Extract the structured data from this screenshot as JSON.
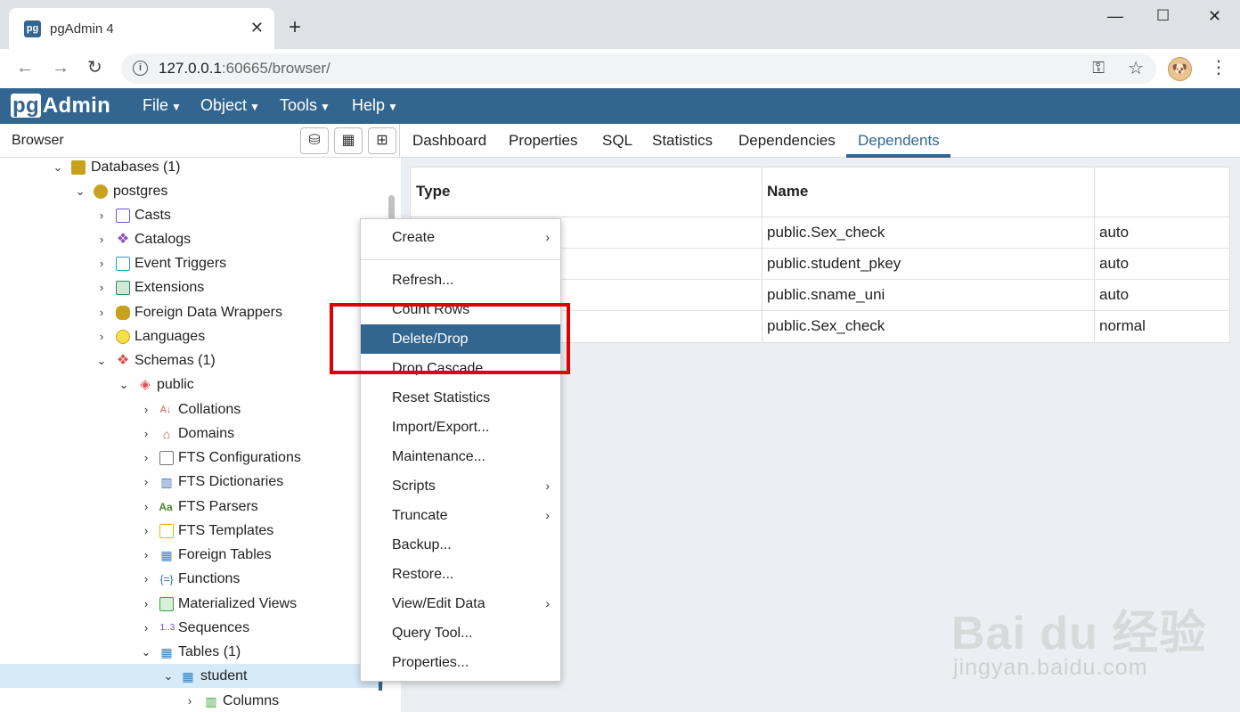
{
  "browser": {
    "tab_title": "pgAdmin 4",
    "tab_favicon": "pg",
    "url_host": "127.0.0.1",
    "url_path": ":60665/browser/"
  },
  "app": {
    "logo_pg": "pg",
    "logo_rest": "Admin",
    "menus": [
      "File",
      "Object",
      "Tools",
      "Help"
    ]
  },
  "left_panel": {
    "title": "Browser",
    "tree": [
      {
        "label": "Databases (1)",
        "icon": "databases-icon",
        "color": "#c8a21f"
      },
      {
        "label": "postgres",
        "icon": "database-icon",
        "color": "#c8a21f"
      },
      {
        "label": "Casts",
        "icon": "casts-icon",
        "color": "#6a5acd"
      },
      {
        "label": "Catalogs",
        "icon": "catalogs-icon",
        "color": "#8a4fbf"
      },
      {
        "label": "Event Triggers",
        "icon": "event-triggers-icon",
        "color": "#2e9ac8"
      },
      {
        "label": "Extensions",
        "icon": "extensions-icon",
        "color": "#2e8b57"
      },
      {
        "label": "Foreign Data Wrappers",
        "icon": "fdw-icon",
        "color": "#c8a21f"
      },
      {
        "label": "Languages",
        "icon": "languages-icon",
        "color": "#e6c400"
      },
      {
        "label": "Schemas (1)",
        "icon": "schemas-icon",
        "color": "#d9534f"
      },
      {
        "label": "public",
        "icon": "schema-icon",
        "color": "#d9534f"
      },
      {
        "label": "Collations",
        "icon": "collations-icon",
        "color": "#d9534f"
      },
      {
        "label": "Domains",
        "icon": "domains-icon",
        "color": "#b0522d"
      },
      {
        "label": "FTS Configurations",
        "icon": "fts-config-icon",
        "color": "#777777"
      },
      {
        "label": "FTS Dictionaries",
        "icon": "fts-dictionaries-icon",
        "color": "#3b6fb6"
      },
      {
        "label": "FTS Parsers",
        "icon": "fts-parsers-icon",
        "color": "#4a8a2a"
      },
      {
        "label": "FTS Templates",
        "icon": "fts-templates-icon",
        "color": "#e6b800"
      },
      {
        "label": "Foreign Tables",
        "icon": "foreign-tables-icon",
        "color": "#2e7fc8"
      },
      {
        "label": "Functions",
        "icon": "functions-icon",
        "color": "#3b6fb6"
      },
      {
        "label": "Materialized Views",
        "icon": "materialized-views-icon",
        "color": "#3aa53a"
      },
      {
        "label": "Sequences",
        "icon": "sequences-icon",
        "color": "#6a4fbf"
      },
      {
        "label": "Tables (1)",
        "icon": "tables-icon",
        "color": "#2e7fc8"
      },
      {
        "label": "student",
        "icon": "table-icon",
        "color": "#2e7fc8"
      },
      {
        "label": "Columns",
        "icon": "columns-icon",
        "color": "#3aa53a"
      }
    ],
    "tree_icon_glyphs": {
      "Collations": "A↓",
      "FTS Parsers": "Aa",
      "Sequences": "1..3"
    }
  },
  "right_panel": {
    "tabs": [
      "Dashboard",
      "Properties",
      "SQL",
      "Statistics",
      "Dependencies",
      "Dependents"
    ],
    "active_tab": "Dependents",
    "table": {
      "headers": [
        "Type",
        "Name",
        ""
      ],
      "rows": [
        [
          "",
          "public.Sex_check",
          "auto"
        ],
        [
          "",
          "public.student_pkey",
          "auto"
        ],
        [
          "",
          "public.sname_uni",
          "auto"
        ],
        [
          "",
          "public.Sex_check",
          "normal"
        ]
      ]
    }
  },
  "context_menu": {
    "items": [
      {
        "label": "Create",
        "submenu": true
      },
      {
        "label": "Refresh...",
        "submenu": false
      },
      {
        "label": "Count Rows",
        "submenu": false
      },
      {
        "label": "Delete/Drop",
        "submenu": false,
        "highlighted": true
      },
      {
        "label": "Drop Cascade",
        "submenu": false
      },
      {
        "label": "Reset Statistics",
        "submenu": false
      },
      {
        "label": "Import/Export...",
        "submenu": false
      },
      {
        "label": "Maintenance...",
        "submenu": false
      },
      {
        "label": "Scripts",
        "submenu": true
      },
      {
        "label": "Truncate",
        "submenu": true
      },
      {
        "label": "Backup...",
        "submenu": false
      },
      {
        "label": "Restore...",
        "submenu": false
      },
      {
        "label": "View/Edit Data",
        "submenu": true
      },
      {
        "label": "Query Tool...",
        "submenu": false
      },
      {
        "label": "Properties...",
        "submenu": false
      }
    ]
  },
  "watermark": {
    "main": "Bai du 经验",
    "sub": "jingyan.baidu.com"
  },
  "colors": {
    "brand": "#326690",
    "highlight_border": "#e00000",
    "selected_row": "#d6eaf8"
  }
}
